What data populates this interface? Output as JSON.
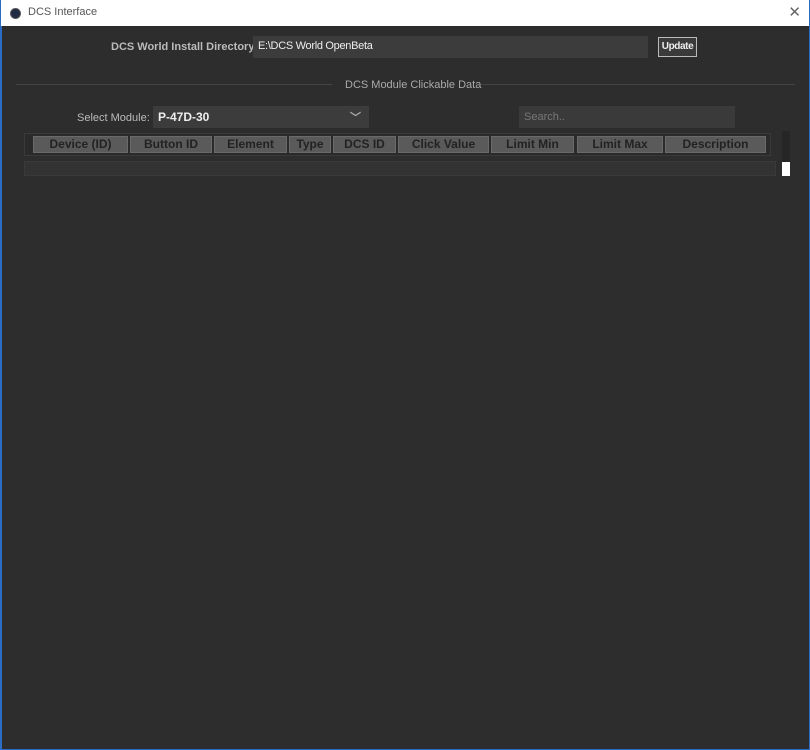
{
  "window": {
    "title": "DCS Interface",
    "close_glyph": "✕"
  },
  "install": {
    "label": "DCS World Install Directory:",
    "value": "E:\\DCS World OpenBeta",
    "update_label": "Update"
  },
  "section": {
    "title": "DCS Module Clickable Data"
  },
  "module": {
    "label": "Select Module:",
    "value": "P-47D-30",
    "chevron": "﹀"
  },
  "search": {
    "placeholder": "Search.."
  },
  "table": {
    "columns": [
      "Device (ID)",
      "Button ID",
      "Element",
      "Type",
      "DCS ID",
      "Click Value",
      "Limit Min",
      "Limit Max",
      "Description"
    ]
  }
}
